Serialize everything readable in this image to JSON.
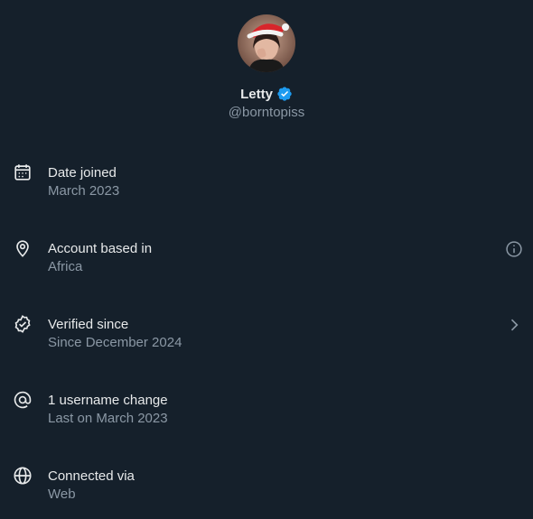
{
  "profile": {
    "name": "Letty",
    "handle": "@borntopiss",
    "verified_color": "#1d9bf0"
  },
  "rows": [
    {
      "icon": "calendar-icon",
      "title": "Date joined",
      "subtitle": "March 2023",
      "trailing": null
    },
    {
      "icon": "location-pin-icon",
      "title": "Account based in",
      "subtitle": "Africa",
      "trailing": "info-icon"
    },
    {
      "icon": "verified-badge-icon",
      "title": "Verified since",
      "subtitle": "Since December 2024",
      "trailing": "chevron-right-icon"
    },
    {
      "icon": "at-sign-icon",
      "title": "1 username change",
      "subtitle": "Last on March 2023",
      "trailing": null
    },
    {
      "icon": "globe-icon",
      "title": "Connected via",
      "subtitle": "Web",
      "trailing": null
    }
  ]
}
